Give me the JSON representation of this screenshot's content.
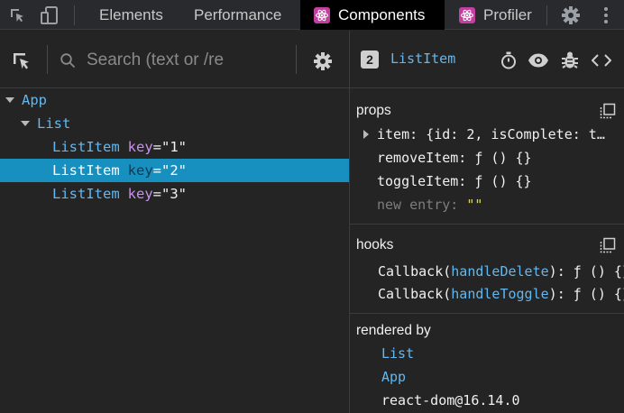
{
  "tabs": [
    {
      "label": "Elements"
    },
    {
      "label": "Performance"
    },
    {
      "label": "Components"
    },
    {
      "label": "Profiler"
    }
  ],
  "search": {
    "placeholder": "Search (text or /re"
  },
  "tree": [
    {
      "name": "App",
      "key_label": "",
      "key_value": ""
    },
    {
      "name": "List",
      "key_label": "",
      "key_value": ""
    },
    {
      "name": "ListItem",
      "key_label": "key",
      "key_value": "=\"1\""
    },
    {
      "name": "ListItem",
      "key_label": "key",
      "key_value": "=\"2\""
    },
    {
      "name": "ListItem",
      "key_label": "key",
      "key_value": "=\"3\""
    }
  ],
  "inspector": {
    "badge": "2",
    "component": "ListItem",
    "props": {
      "title": "props",
      "rows": [
        {
          "key": "item:",
          "value": "{id: 2, isComplete: t…"
        },
        {
          "key": "removeItem:",
          "value": "ƒ () {}"
        },
        {
          "key": "toggleItem:",
          "value": "ƒ () {}"
        },
        {
          "key": "new entry:",
          "value": "\"\""
        }
      ]
    },
    "hooks": {
      "title": "hooks",
      "rows": [
        {
          "name": "Callback",
          "fn": "handleDelete",
          "value": ": ƒ () {}"
        },
        {
          "name": "Callback",
          "fn": "handleToggle",
          "value": ": ƒ () {}"
        }
      ]
    },
    "rendered_by": {
      "title": "rendered by",
      "items": [
        "List",
        "App",
        "react-dom@16.14.0"
      ]
    }
  },
  "colors": {
    "selection": "#178fbf",
    "component_name": "#61b8f0",
    "key_attr": "#c792ea",
    "string": "#e5d94a"
  },
  "icons": [
    "inspect-cursor-icon",
    "device-toggle-icon",
    "react-logo-icon",
    "gear-icon",
    "more-vertical-icon",
    "search-icon",
    "stopwatch-icon",
    "eye-icon",
    "bug-icon",
    "code-icon",
    "copy-icon",
    "triangle-expand-icon"
  ]
}
